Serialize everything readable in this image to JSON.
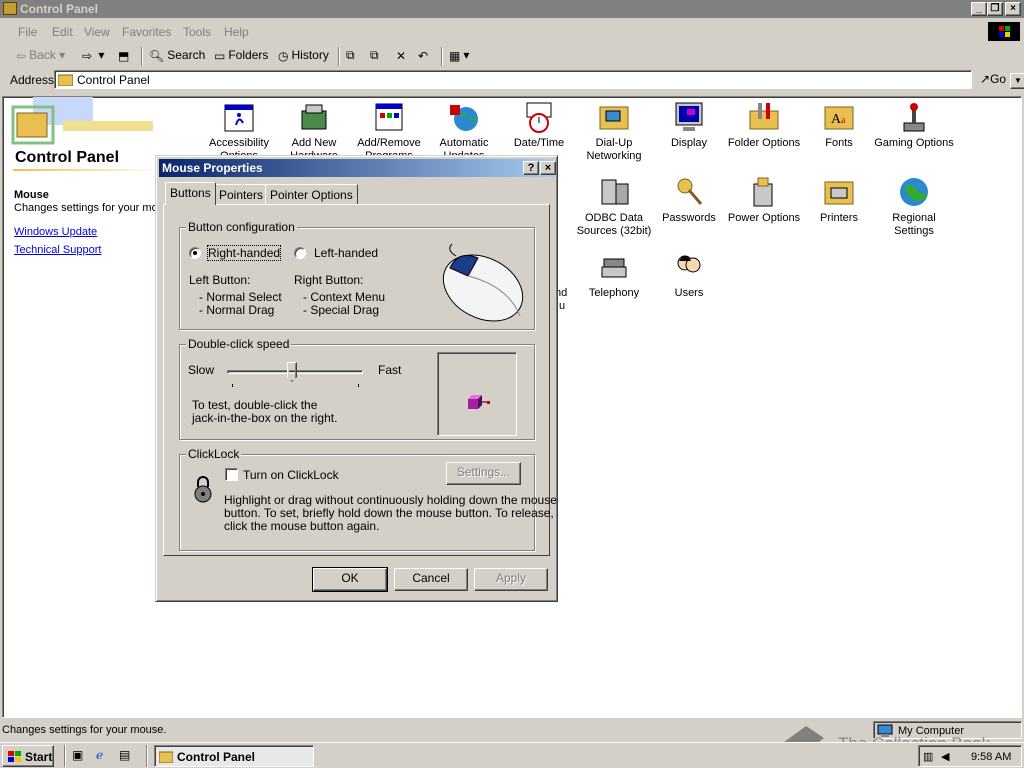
{
  "window": {
    "title": "Control Panel"
  },
  "menu": [
    "File",
    "Edit",
    "View",
    "Favorites",
    "Tools",
    "Help"
  ],
  "toolbar": {
    "back": "Back",
    "search": "Search",
    "folders": "Folders",
    "history": "History"
  },
  "address": {
    "label": "Address",
    "value": "Control Panel",
    "go": "Go"
  },
  "left_pane": {
    "title": "Control Panel",
    "selected_name": "Mouse",
    "selected_desc": "Changes settings for your mo",
    "links": [
      "Windows Update",
      "Technical Support"
    ]
  },
  "icons": [
    {
      "label": "Accessibility Options",
      "icon": "accessibility-icon"
    },
    {
      "label": "Add New Hardware",
      "icon": "add-hardware-icon"
    },
    {
      "label": "Add/Remove Programs",
      "icon": "add-remove-programs-icon"
    },
    {
      "label": "Automatic Updates",
      "icon": "automatic-updates-icon"
    },
    {
      "label": "Date/Time",
      "icon": "date-time-icon"
    },
    {
      "label": "Dial-Up Networking",
      "icon": "dialup-networking-icon"
    },
    {
      "label": "Display",
      "icon": "display-icon"
    },
    {
      "label": "Folder Options",
      "icon": "folder-options-icon"
    },
    {
      "label": "Fonts",
      "icon": "fonts-icon"
    },
    {
      "label": "Gaming Options",
      "icon": "gaming-options-icon"
    },
    {
      "label": "ODBC Data Sources (32bit)",
      "icon": "odbc-icon"
    },
    {
      "label": "Passwords",
      "icon": "passwords-icon"
    },
    {
      "label": "Power Options",
      "icon": "power-options-icon"
    },
    {
      "label": "Printers",
      "icon": "printers-icon"
    },
    {
      "label": "Regional Settings",
      "icon": "regional-settings-icon"
    },
    {
      "label": "Telephony",
      "icon": "telephony-icon"
    },
    {
      "label": "Users",
      "icon": "users-icon"
    }
  ],
  "partial_icon_text": [
    "nd",
    "u"
  ],
  "dialog": {
    "title": "Mouse Properties",
    "help": "?",
    "close": "×",
    "tabs": [
      "Buttons",
      "Pointers",
      "Pointer Options"
    ],
    "button_config": {
      "label": "Button configuration",
      "right_handed": "Right-handed",
      "left_handed": "Left-handed",
      "left_button_label": "Left Button:",
      "left_button_items": [
        "- Normal Select",
        "- Normal Drag"
      ],
      "right_button_label": "Right Button:",
      "right_button_items": [
        "- Context Menu",
        "- Special Drag"
      ]
    },
    "double_click": {
      "label": "Double-click speed",
      "slow": "Slow",
      "fast": "Fast",
      "level": 0.5,
      "test_text_1": "To test, double-click the",
      "test_text_2": "jack-in-the-box on the right."
    },
    "clicklock": {
      "label": "ClickLock",
      "checkbox": "Turn on ClickLock",
      "settings": "Settings...",
      "desc": [
        "Highlight or drag without continuously holding down the mouse",
        "button. To set, briefly hold down the mouse button. To release,",
        "click the mouse button again."
      ]
    },
    "ok": "OK",
    "cancel": "Cancel",
    "apply": "Apply"
  },
  "status": {
    "text": "Changes settings for your mouse.",
    "zone": "My Computer"
  },
  "taskbar": {
    "start": "Start",
    "task": "Control Panel",
    "clock": "9:58 AM"
  },
  "watermark": "The Collection Book",
  "colors": {
    "face": "#d4d0c8",
    "title_active": "#0a246a",
    "title_inactive": "#808080",
    "link": "#0000ee"
  }
}
